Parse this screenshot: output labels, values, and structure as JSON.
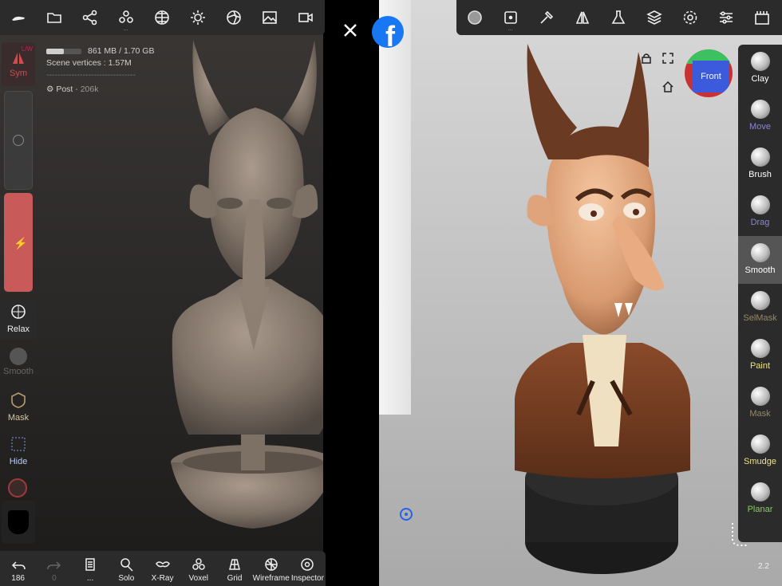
{
  "top_toolbar_left": {
    "items": [
      "scene-icon",
      "files-icon",
      "share-graph-icon",
      "objects-icon",
      "topology-icon",
      "lighting-icon",
      "material-icon",
      "background-icon",
      "video-icon"
    ]
  },
  "top_toolbar_right": {
    "items": [
      "material-sphere-icon",
      "stroke-icon",
      "tool-icon",
      "symmetry-icon",
      "flask-icon",
      "layers-icon",
      "settings-icon",
      "sliders-icon",
      "interface-icon"
    ]
  },
  "stats": {
    "memory": "861 MB / 1.70 GB",
    "scene_vertices": "Scene vertices : 1.57M",
    "separator": "--------------------------------",
    "post_label": "Post",
    "post_count": "- 206k"
  },
  "left_tools": {
    "sym_label": "Sym",
    "sym_sub": "L/W",
    "relax": "Relax",
    "smooth": "Smooth",
    "mask": "Mask",
    "hide": "Hide"
  },
  "bottom_toolbar": [
    {
      "label": "186",
      "icon": "undo-icon",
      "dim": false
    },
    {
      "label": "0",
      "icon": "redo-icon",
      "dim": true
    },
    {
      "label": "...",
      "icon": "history-icon",
      "dim": false
    },
    {
      "label": "Solo",
      "icon": "solo-icon",
      "dim": false
    },
    {
      "label": "X-Ray",
      "icon": "xray-icon",
      "dim": false
    },
    {
      "label": "Voxel",
      "icon": "voxel-icon",
      "dim": false
    },
    {
      "label": "Grid",
      "icon": "grid-icon",
      "dim": false
    },
    {
      "label": "Wireframe",
      "icon": "wireframe-icon",
      "dim": false
    },
    {
      "label": "Inspector",
      "icon": "inspector-icon",
      "dim": false
    }
  ],
  "right_tools": [
    {
      "label": "Clay",
      "color": "#ffffff"
    },
    {
      "label": "Move",
      "color": "#8b85d8"
    },
    {
      "label": "Brush",
      "color": "#ffffff"
    },
    {
      "label": "Drag",
      "color": "#8b85d8"
    },
    {
      "label": "Smooth",
      "color": "#ffffff",
      "active": true
    },
    {
      "label": "SelMask",
      "color": "#9a8766"
    },
    {
      "label": "Paint",
      "color": "#f0e27a"
    },
    {
      "label": "Mask",
      "color": "#9a8766"
    },
    {
      "label": "Smudge",
      "color": "#f0e27a"
    },
    {
      "label": "Planar",
      "color": "#7fd05a"
    }
  ],
  "nav_cube": {
    "label": "Front"
  },
  "version": "2.2",
  "colors": {
    "accent_red": "#c85a5a",
    "toolbar_bg": "#2b2b2b",
    "facebook_blue": "#1877f2"
  }
}
